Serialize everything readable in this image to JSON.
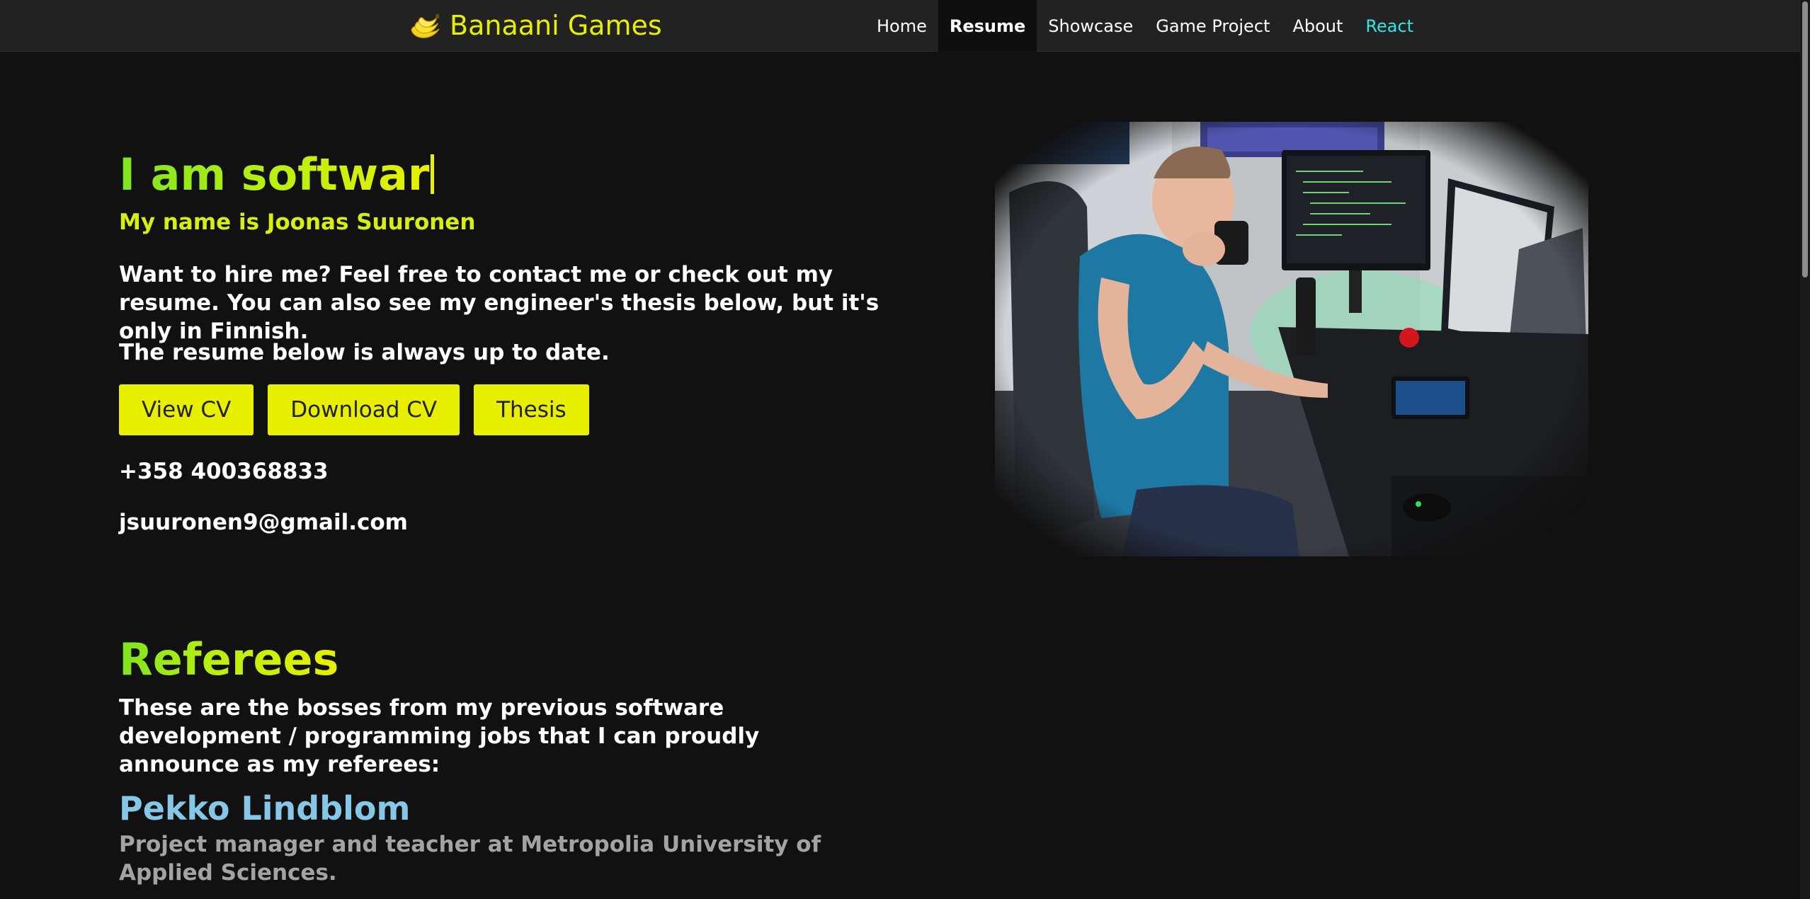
{
  "navbar": {
    "brand": "Banaani Games",
    "links": [
      {
        "label": "Home"
      },
      {
        "label": "Resume",
        "active": true
      },
      {
        "label": "Showcase"
      },
      {
        "label": "Game Project"
      },
      {
        "label": "About"
      },
      {
        "label": "React"
      }
    ]
  },
  "hero": {
    "headline": "I am softwar",
    "subtitle": "My name is Joonas Suuronen",
    "intro": "Want to hire me? Feel free to contact me or check out my resume. You can also see my engineer's thesis below, but it's only in Finnish.",
    "note": "The resume below is always up to date.",
    "buttons": {
      "view_cv": "View CV",
      "download_cv": "Download CV",
      "thesis": "Thesis"
    },
    "phone": "+358 400368833",
    "email": "jsuuronen9@gmail.com"
  },
  "referees": {
    "title": "Referees",
    "intro": "These are the bosses from my previous software development / programming jobs that I can proudly announce as my referees:",
    "items": [
      {
        "name": "Pekko Lindblom",
        "role": "Project manager and teacher at Metropolia University of Applied Sciences."
      }
    ]
  },
  "colors": {
    "background": "#111111",
    "navbar": "#222222",
    "accent_yellow": "#e8f000",
    "accent_green": "#7ee321",
    "react_link": "#2ee6e6",
    "referee_name": "#86c6e6",
    "referee_role": "#a3a3a3"
  },
  "icons": {
    "brand": "banana-icon"
  }
}
